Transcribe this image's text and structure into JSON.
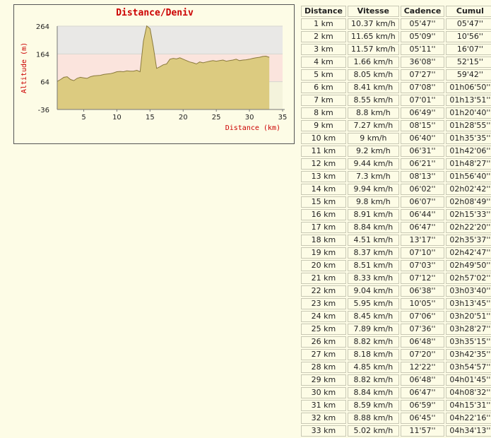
{
  "chart_data": {
    "type": "area",
    "title": "Distance/Deniv",
    "xlabel": "Distance (km)",
    "ylabel": "Altitude (m)",
    "xlim": [
      1,
      35
    ],
    "ylim": [
      -36,
      264
    ],
    "xticks": [
      5,
      10,
      15,
      20,
      25,
      30,
      35
    ],
    "yticks": [
      -36,
      64,
      164,
      264
    ],
    "ytick_labels": [
      "-36",
      "64",
      "164",
      "264"
    ],
    "grid": "horizontal",
    "colors": {
      "fill": "#dccb80",
      "stroke": "#8a7a3c",
      "title": "#cc0000",
      "axis_label": "#cc0000",
      "band_upper": "#fbe4dd",
      "band_lower": "#f4f3dc",
      "band_top": "#e9e8e6"
    },
    "x": [
      1,
      1.5,
      2,
      2.5,
      3,
      3.5,
      4,
      4.5,
      5,
      5.5,
      6,
      6.5,
      7,
      7.5,
      8,
      8.5,
      9,
      9.5,
      10,
      10.5,
      11,
      11.5,
      12,
      12.5,
      13,
      13.5,
      14,
      14.5,
      15,
      15.5,
      16,
      16.5,
      17,
      17.5,
      18,
      18.5,
      19,
      19.5,
      20,
      20.5,
      21,
      21.5,
      22,
      22.5,
      23,
      23.5,
      24,
      24.5,
      25,
      25.5,
      26,
      26.5,
      27,
      27.5,
      28,
      28.5,
      29,
      29.5,
      30,
      30.5,
      31,
      31.5,
      32,
      32.5,
      33
    ],
    "y": [
      65,
      72,
      80,
      82,
      72,
      68,
      76,
      80,
      78,
      76,
      82,
      85,
      86,
      87,
      90,
      92,
      93,
      96,
      100,
      101,
      100,
      103,
      102,
      102,
      105,
      100,
      210,
      265,
      255,
      190,
      112,
      118,
      125,
      128,
      145,
      148,
      146,
      150,
      145,
      140,
      135,
      132,
      128,
      135,
      132,
      135,
      138,
      140,
      138,
      140,
      142,
      138,
      140,
      142,
      145,
      140,
      142,
      143,
      145,
      148,
      150,
      152,
      155,
      156,
      152
    ]
  },
  "table": {
    "headers": [
      "Distance",
      "Vitesse",
      "Cadence",
      "Cumul"
    ],
    "rows": [
      [
        "1 km",
        "10.37 km/h",
        "05'47''",
        "05'47''"
      ],
      [
        "2 km",
        "11.65 km/h",
        "05'09''",
        "10'56''"
      ],
      [
        "3 km",
        "11.57 km/h",
        "05'11''",
        "16'07''"
      ],
      [
        "4 km",
        "1.66 km/h",
        "36'08''",
        "52'15''"
      ],
      [
        "5 km",
        "8.05 km/h",
        "07'27''",
        "59'42''"
      ],
      [
        "6 km",
        "8.41 km/h",
        "07'08''",
        "01h06'50''"
      ],
      [
        "7 km",
        "8.55 km/h",
        "07'01''",
        "01h13'51''"
      ],
      [
        "8 km",
        "8.8 km/h",
        "06'49''",
        "01h20'40''"
      ],
      [
        "9 km",
        "7.27 km/h",
        "08'15''",
        "01h28'55''"
      ],
      [
        "10 km",
        "9 km/h",
        "06'40''",
        "01h35'35''"
      ],
      [
        "11 km",
        "9.2 km/h",
        "06'31''",
        "01h42'06''"
      ],
      [
        "12 km",
        "9.44 km/h",
        "06'21''",
        "01h48'27''"
      ],
      [
        "13 km",
        "7.3 km/h",
        "08'13''",
        "01h56'40''"
      ],
      [
        "14 km",
        "9.94 km/h",
        "06'02''",
        "02h02'42''"
      ],
      [
        "15 km",
        "9.8 km/h",
        "06'07''",
        "02h08'49''"
      ],
      [
        "16 km",
        "8.91 km/h",
        "06'44''",
        "02h15'33''"
      ],
      [
        "17 km",
        "8.84 km/h",
        "06'47''",
        "02h22'20''"
      ],
      [
        "18 km",
        "4.51 km/h",
        "13'17''",
        "02h35'37''"
      ],
      [
        "19 km",
        "8.37 km/h",
        "07'10''",
        "02h42'47''"
      ],
      [
        "20 km",
        "8.51 km/h",
        "07'03''",
        "02h49'50''"
      ],
      [
        "21 km",
        "8.33 km/h",
        "07'12''",
        "02h57'02''"
      ],
      [
        "22 km",
        "9.04 km/h",
        "06'38''",
        "03h03'40''"
      ],
      [
        "23 km",
        "5.95 km/h",
        "10'05''",
        "03h13'45''"
      ],
      [
        "24 km",
        "8.45 km/h",
        "07'06''",
        "03h20'51''"
      ],
      [
        "25 km",
        "7.89 km/h",
        "07'36''",
        "03h28'27''"
      ],
      [
        "26 km",
        "8.82 km/h",
        "06'48''",
        "03h35'15''"
      ],
      [
        "27 km",
        "8.18 km/h",
        "07'20''",
        "03h42'35''"
      ],
      [
        "28 km",
        "4.85 km/h",
        "12'22''",
        "03h54'57''"
      ],
      [
        "29 km",
        "8.82 km/h",
        "06'48''",
        "04h01'45''"
      ],
      [
        "30 km",
        "8.84 km/h",
        "06'47''",
        "04h08'32''"
      ],
      [
        "31 km",
        "8.59 km/h",
        "06'59''",
        "04h15'31''"
      ],
      [
        "32 km",
        "8.88 km/h",
        "06'45''",
        "04h22'16''"
      ],
      [
        "33 km",
        "5.02 km/h",
        "11'57''",
        "04h34'13''"
      ]
    ]
  }
}
